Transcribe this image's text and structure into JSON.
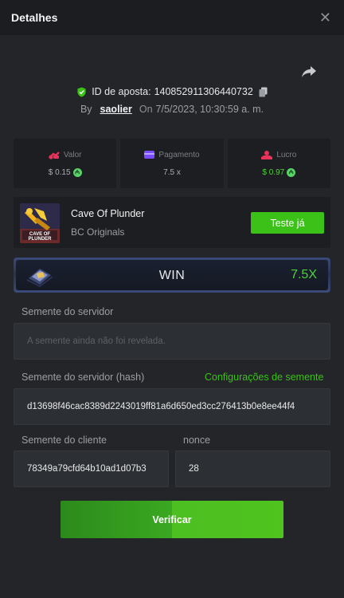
{
  "header": {
    "title": "Detalhes",
    "close_glyph": "✕"
  },
  "bet": {
    "id_label": "ID de aposta:",
    "id_value": "140852911306440732",
    "by_label": "By",
    "username": "saolier",
    "on_label": "On",
    "datetime": "7/5/2023, 10:30:59 a. m."
  },
  "stats": {
    "valor": {
      "label": "Valor",
      "value": "$ 0.15",
      "icon": "bet-coins-icon",
      "color": "#e8325a"
    },
    "pagamento": {
      "label": "Pagamento",
      "value": "7.5 x",
      "icon": "payout-card-icon",
      "color": "#7b4bff"
    },
    "lucro": {
      "label": "Lucro",
      "value": "$ 0.97",
      "icon": "profit-icon",
      "color": "#e8325a"
    }
  },
  "game": {
    "thumb_text": "CAVE OF PLUNDER",
    "name": "Cave Of Plunder",
    "provider": "BC Originals",
    "try_label": "Teste já"
  },
  "result": {
    "label": "WIN",
    "multiplier": "7.5X"
  },
  "server_seed": {
    "label": "Semente do servidor",
    "placeholder": "A semente ainda não foi revelada."
  },
  "server_hash": {
    "label": "Semente do servidor (hash)",
    "config_link": "Configurações de semente",
    "value": "d13698f46cac8389d2243019ff81a6d650ed3cc276413b0e8ee44f4"
  },
  "client_seed": {
    "label": "Semente do cliente",
    "value": "78349a79cfd64b10ad1d07b3"
  },
  "nonce": {
    "label": "nonce",
    "value": "28"
  },
  "verify_label": "Verificar",
  "colors": {
    "accent_green": "#3bc117",
    "background": "#232529",
    "card": "#1c1e21"
  }
}
